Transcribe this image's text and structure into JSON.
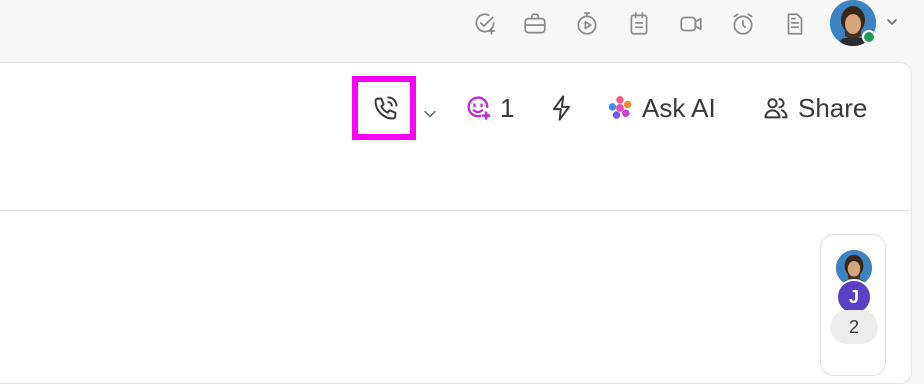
{
  "topbar": {
    "icons": [
      "task-add-icon",
      "briefcase-icon",
      "timer-play-icon",
      "clipboard-icon",
      "video-camera-icon",
      "alarm-clock-icon",
      "document-icon"
    ],
    "status_color": "#1f9d55"
  },
  "toolbar": {
    "call_icon": "phone-call-icon",
    "assignees_count": "1",
    "ask_ai_label": "Ask AI",
    "share_label": "Share",
    "highlight_color": "#ff00ff"
  },
  "side_card": {
    "initial": "J",
    "count": "2",
    "j_color": "#5b3fc4"
  }
}
